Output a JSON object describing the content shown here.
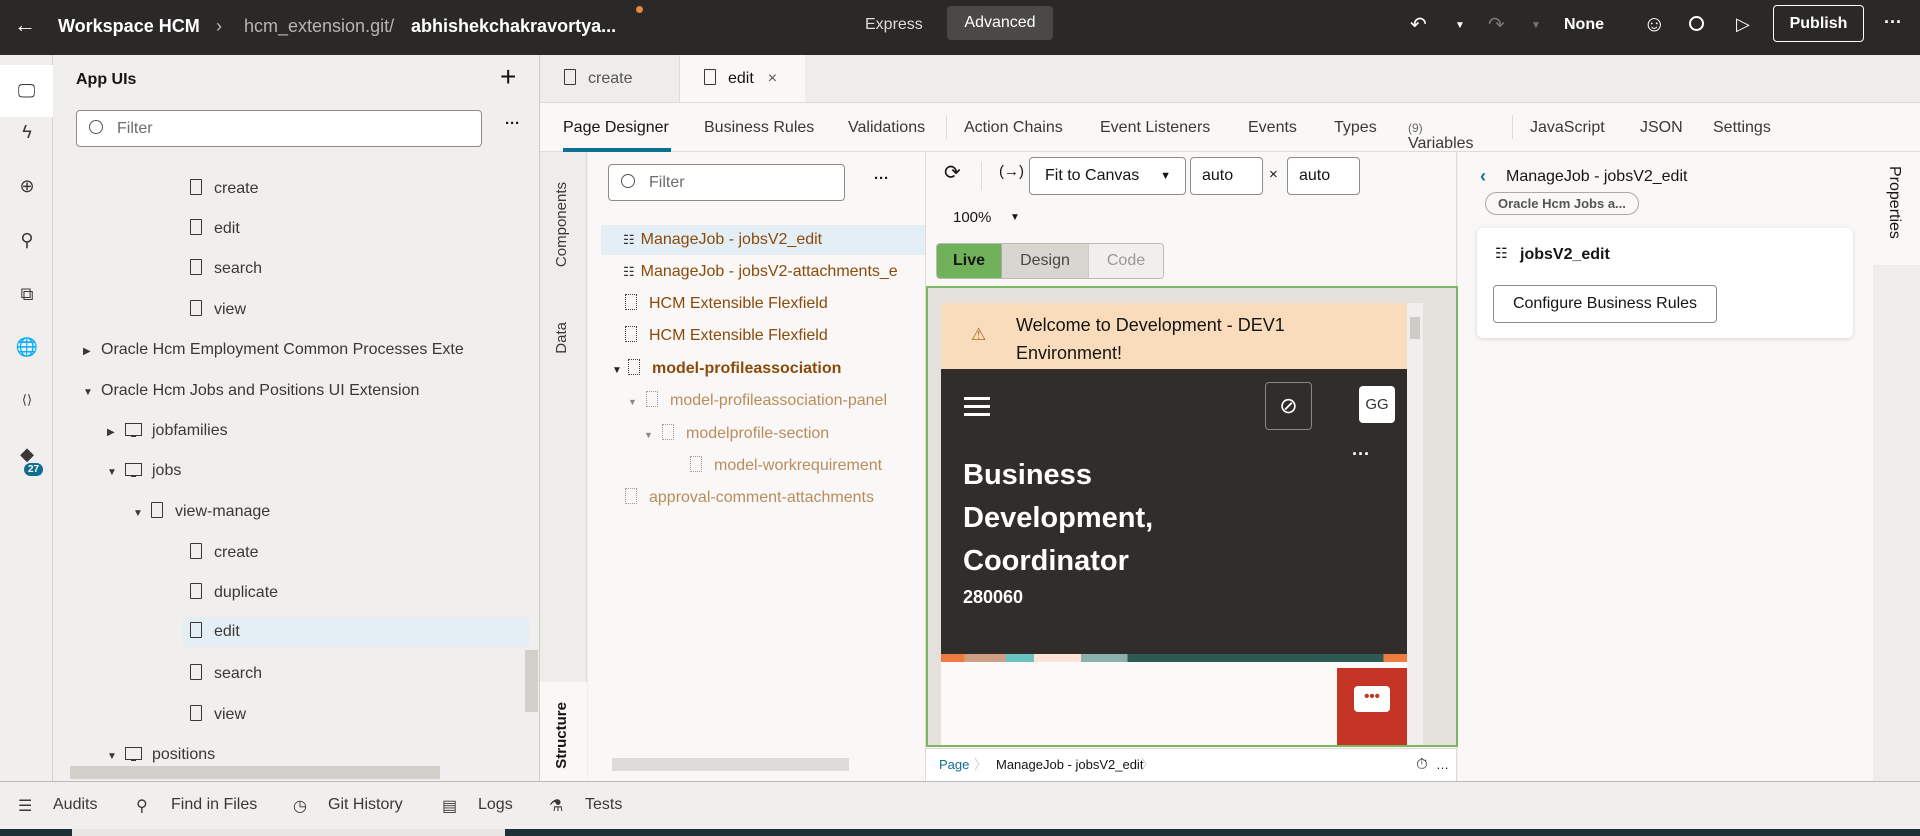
{
  "header": {
    "back_icon": "arrow-left-icon",
    "workspace": "Workspace HCM",
    "repo": "hcm_extension.git/",
    "branch": "abhishekchakravortya...",
    "modes": [
      "Express",
      "Advanced"
    ],
    "active_mode": "Advanced",
    "none_label": "None",
    "publish": "Publish"
  },
  "rail": {
    "icons": [
      "app-uis-icon",
      "events-icon",
      "services-icon",
      "plug-icon",
      "puzzle-icon",
      "globe-icon",
      "source-icon",
      "git-icon"
    ],
    "git_badge": "27"
  },
  "app_uis": {
    "title": "App UIs",
    "filter_placeholder": "Filter",
    "tree": [
      {
        "label": "view-manage",
        "type": "flow",
        "level": 2
      },
      {
        "label": "create",
        "type": "page",
        "level": 3
      },
      {
        "label": "edit",
        "type": "page",
        "level": 3
      },
      {
        "label": "search",
        "type": "page",
        "level": 3
      },
      {
        "label": "view",
        "type": "page",
        "level": 3
      },
      {
        "label": "Oracle Hcm Employment Common Processes Exte",
        "type": "app",
        "level": 0,
        "expanded": false
      },
      {
        "label": "Oracle Hcm Jobs and Positions UI Extension",
        "type": "app",
        "level": 0,
        "expanded": true
      },
      {
        "label": "jobfamilies",
        "type": "ui",
        "level": 1,
        "expanded": false
      },
      {
        "label": "jobs",
        "type": "ui",
        "level": 1,
        "expanded": true
      },
      {
        "label": "view-manage",
        "type": "flow",
        "level": 2,
        "expanded": true
      },
      {
        "label": "create",
        "type": "page",
        "level": 3
      },
      {
        "label": "duplicate",
        "type": "page",
        "level": 3
      },
      {
        "label": "edit",
        "type": "page",
        "level": 3,
        "selected": true
      },
      {
        "label": "search",
        "type": "page",
        "level": 3
      },
      {
        "label": "view",
        "type": "page",
        "level": 3
      },
      {
        "label": "positions",
        "type": "ui",
        "level": 1,
        "expanded": true
      }
    ]
  },
  "editor_tabs": [
    {
      "label": "create"
    },
    {
      "label": "edit",
      "active": true,
      "close": "×"
    }
  ],
  "sub_tabs": [
    "Page Designer",
    "Business Rules",
    "Validations",
    "Action Chains",
    "Event Listeners",
    "Events",
    "Types",
    "Variables",
    "JavaScript",
    "JSON",
    "Settings"
  ],
  "variables_count": "(9)",
  "side_tabs": {
    "components": "Components",
    "data": "Data",
    "structure": "Structure"
  },
  "structure": {
    "filter_placeholder": "Filter",
    "items": [
      {
        "label": "ManageJob - jobsV2_edit",
        "selected": true
      },
      {
        "label": "ManageJob - jobsV2-attachments_e"
      },
      {
        "label": "HCM Extensible Flexfield"
      },
      {
        "label": "HCM Extensible Flexfield"
      },
      {
        "label": "model-profileassociation"
      },
      {
        "label": "model-profileassociation-panel"
      },
      {
        "label": "modelprofile-section"
      },
      {
        "label": "model-workrequirement"
      },
      {
        "label": "approval-comment-attachments"
      }
    ]
  },
  "canvas": {
    "fit": "Fit to Canvas",
    "width": "auto",
    "times": "×",
    "height": "auto",
    "zoom": "100%",
    "modes": [
      "Live",
      "Design",
      "Code"
    ],
    "active_mode": "Live",
    "banner": "Welcome to Development - DEV1 Environment!",
    "avatar": "GG",
    "job_title": "Business Development, Coordinator",
    "job_code": "280060"
  },
  "breadcrumb": [
    "Page",
    "ManageJob - jobsV2_edit"
  ],
  "properties": {
    "title": "ManageJob - jobsV2_edit",
    "pill": "Oracle Hcm Jobs a...",
    "card_title": "jobsV2_edit",
    "button": "Configure Business Rules",
    "tab": "Properties"
  },
  "bottom_bar": [
    "Audits",
    "Find in Files",
    "Git History",
    "Logs",
    "Tests"
  ],
  "colors": {
    "accent": "#0f6f90",
    "live_green": "#6fb25a",
    "brown": "#8b4a0c",
    "chat_red": "#c43424"
  }
}
